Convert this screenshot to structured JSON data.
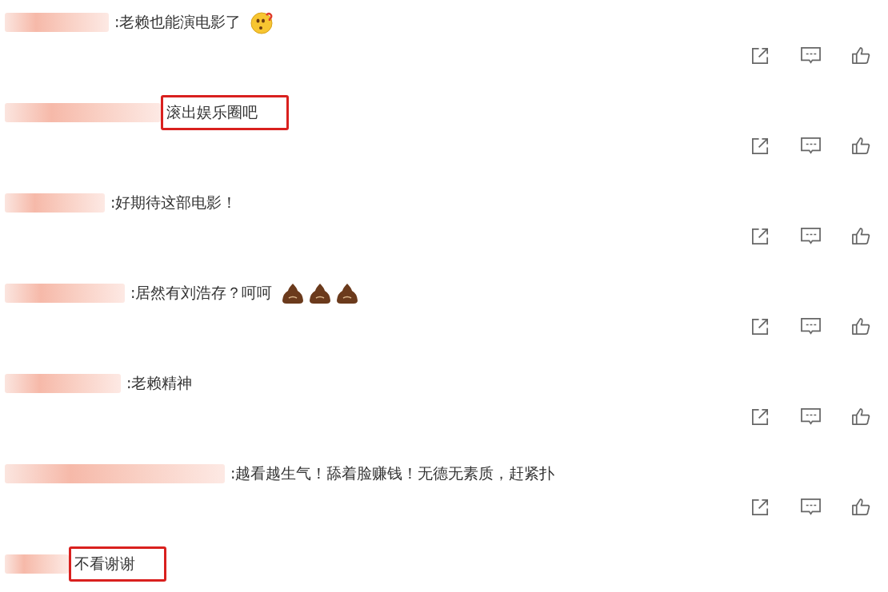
{
  "comments": [
    {
      "text": ":老赖也能演电影了",
      "highlighted": false,
      "emojis": [
        {
          "kind": "puzzled-face"
        }
      ]
    },
    {
      "text": "滚出娱乐圈吧",
      "highlighted": true
    },
    {
      "text": ":好期待这部电影！",
      "highlighted": false
    },
    {
      "text": ":居然有刘浩存？呵呵",
      "highlighted": false,
      "emojis": [
        {
          "kind": "poop"
        },
        {
          "kind": "poop"
        },
        {
          "kind": "poop"
        }
      ]
    },
    {
      "text": ":老赖精神",
      "highlighted": false
    },
    {
      "text": ":越看越生气！舔着脸赚钱！无德无素质，赶紧扑",
      "highlighted": false
    },
    {
      "text": "不看谢谢",
      "highlighted": true
    }
  ]
}
